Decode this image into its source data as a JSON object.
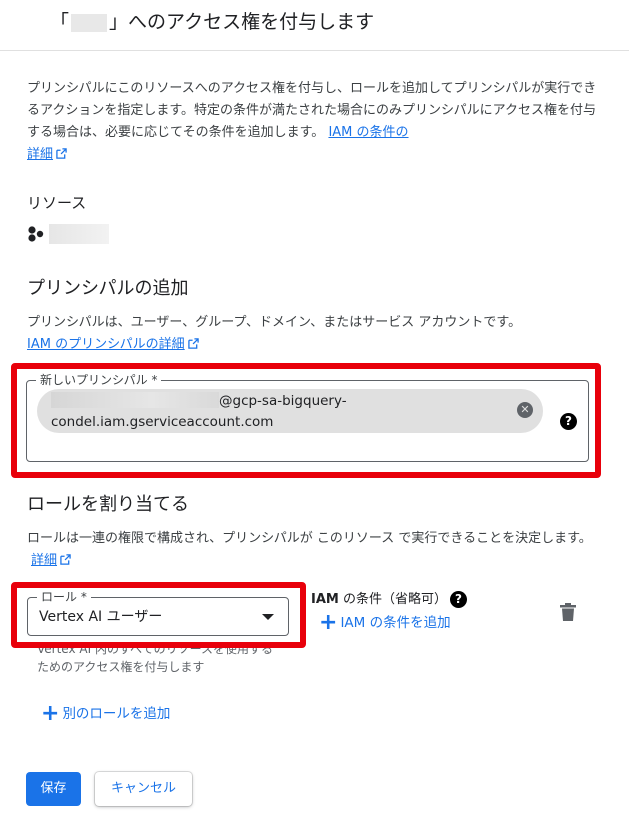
{
  "dialog": {
    "title_prefix": "「",
    "title_suffix": "」へのアクセス権を付与します"
  },
  "intro": {
    "text": "プリンシパルにこのリソースへのアクセス権を付与し、ロールを追加してプリンシパルが実行できるアクションを指定します。特定の条件が満たされた場合にのみプリンシパルにアクセス権を付与する場合は、必要に応じてその条件を追加します。",
    "link_label_1": "IAM の条件の",
    "link_label_2": "詳細"
  },
  "resource": {
    "heading": "リソース"
  },
  "principals": {
    "heading": "プリンシパルの追加",
    "description": "プリンシパルは、ユーザー、グループ、ドメイン、またはサービス アカウントです。",
    "link_label": "IAM のプリンシパルの詳細",
    "field_label": "新しいプリンシパル *",
    "chip_line1_suffix": "@gcp-sa-bigquery-",
    "chip_line2": "condel.iam.gserviceaccount.com",
    "chip_close_glyph": "✕",
    "help_glyph": "?"
  },
  "roles": {
    "heading": "ロールを割り当てる",
    "description": "ロールは一連の権限で構成され、プリンシパルが このリソース で実行できることを決定します。",
    "link_label": "詳細",
    "field_label": "ロール *",
    "selected_role": "Vertex AI ユーザー",
    "hint_text": "Vertex AI 内のすべてのリソースを使用するためのアクセス権を付与します",
    "condition_label_bold": "IAM",
    "condition_label_rest": " の条件（省略可）",
    "add_condition_label": "IAM の条件を追加",
    "add_role_label": "別のロールを追加",
    "help_glyph": "?",
    "plus_glyph": "+"
  },
  "actions": {
    "save_label": "保存",
    "cancel_label": "キャンセル"
  },
  "colors": {
    "accent": "#1a73e8",
    "highlight_red": "#e8000b"
  }
}
